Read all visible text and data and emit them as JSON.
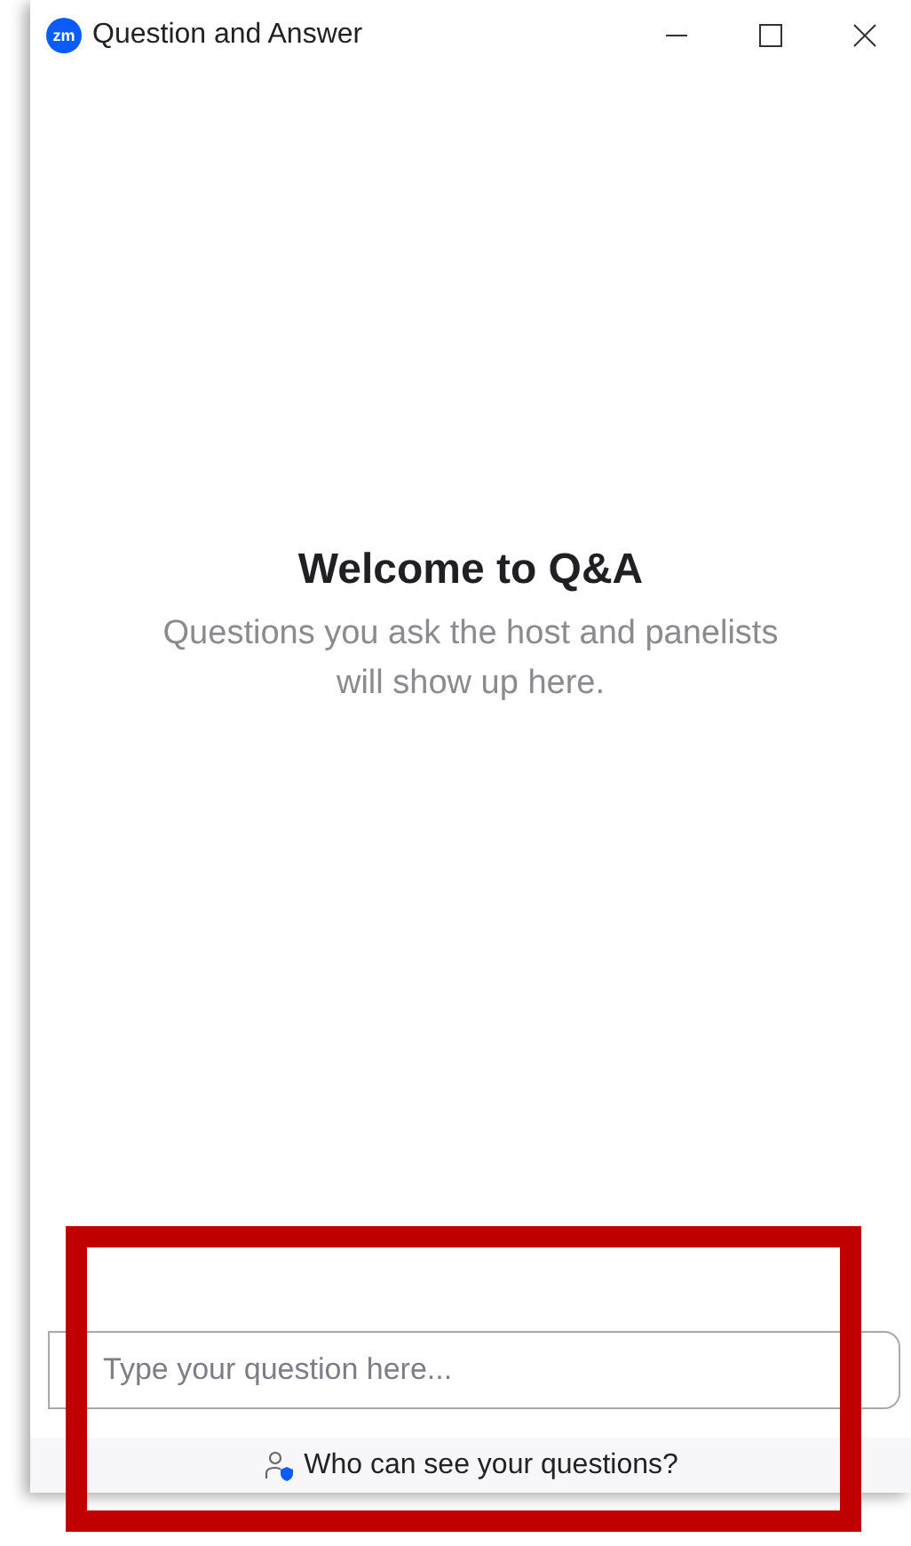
{
  "window": {
    "app_icon": "zm",
    "title": "Question and Answer"
  },
  "welcome": {
    "heading": "Welcome to Q&A",
    "message": "Questions you ask the host and panelists will show up here."
  },
  "question_field": {
    "placeholder": "Type your question here..."
  },
  "privacy_link": {
    "label": "Who can see your questions?"
  },
  "annotations": [
    {
      "kind": "frame"
    }
  ]
}
